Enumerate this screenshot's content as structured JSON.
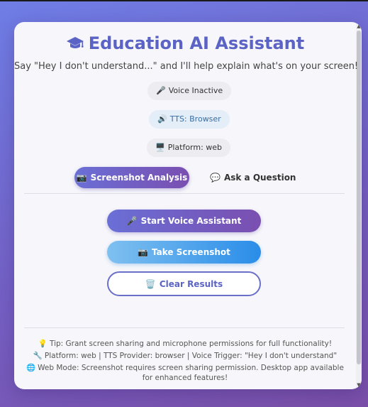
{
  "app": {
    "title": "Education AI Assistant",
    "subtitle": "Say \"Hey I don't understand...\" and I'll help explain what's on your screen!"
  },
  "status": {
    "voice": "Voice Inactive",
    "tts": "TTS: Browser",
    "platform": "Platform: web"
  },
  "tabs": [
    {
      "label": "Screenshot Analysis",
      "active": true
    },
    {
      "label": "Ask a Question",
      "active": false
    }
  ],
  "actions": {
    "start_voice": "Start Voice Assistant",
    "take_screenshot": "Take Screenshot",
    "clear_results": "Clear Results"
  },
  "footer": {
    "tip": "Tip: Grant screen sharing and microphone permissions for full functionality!",
    "info": "Platform: web | TTS Provider: browser | Voice Trigger: \"Hey I don't understand\"",
    "web_mode": "Web Mode: Screenshot requires screen sharing permission. Desktop app available for enhanced features!"
  },
  "icons": {
    "title": "graduation-cap-icon",
    "voice": "microphone-icon",
    "tts": "speaker-icon",
    "platform": "monitor-icon",
    "screenshot_tab": "camera-icon",
    "question_tab": "speech-bubble-icon",
    "start_voice": "microphone-icon",
    "take_screenshot": "camera-icon",
    "clear_results": "trash-icon",
    "tip": "lightbulb-icon",
    "info": "wrench-icon",
    "web_mode": "globe-icon"
  },
  "colors": {
    "accent": "#5b63c4",
    "primary_gradient_start": "#6a6fd6",
    "primary_gradient_end": "#7a4fb0",
    "secondary_gradient_start": "#7fc0f0",
    "secondary_gradient_end": "#2a8de8"
  }
}
